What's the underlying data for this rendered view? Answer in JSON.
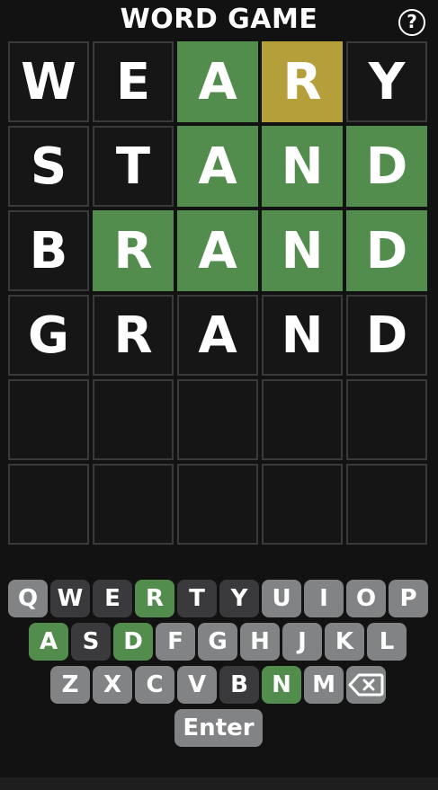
{
  "header": {
    "title": "WORD GAME",
    "help_label": "?"
  },
  "colors": {
    "correct": "#538d4e",
    "present": "#b59f3b",
    "absent": "#3a3a3c",
    "unused_key": "#818384",
    "background": "#121212"
  },
  "board": {
    "rows": [
      [
        {
          "letter": "W",
          "state": "absent"
        },
        {
          "letter": "E",
          "state": "absent"
        },
        {
          "letter": "A",
          "state": "correct"
        },
        {
          "letter": "R",
          "state": "present"
        },
        {
          "letter": "Y",
          "state": "absent"
        }
      ],
      [
        {
          "letter": "S",
          "state": "absent"
        },
        {
          "letter": "T",
          "state": "absent"
        },
        {
          "letter": "A",
          "state": "correct"
        },
        {
          "letter": "N",
          "state": "correct"
        },
        {
          "letter": "D",
          "state": "correct"
        }
      ],
      [
        {
          "letter": "B",
          "state": "absent"
        },
        {
          "letter": "R",
          "state": "correct"
        },
        {
          "letter": "A",
          "state": "correct"
        },
        {
          "letter": "N",
          "state": "correct"
        },
        {
          "letter": "D",
          "state": "correct"
        }
      ],
      [
        {
          "letter": "G",
          "state": "absent"
        },
        {
          "letter": "R",
          "state": "absent"
        },
        {
          "letter": "A",
          "state": "absent"
        },
        {
          "letter": "N",
          "state": "absent"
        },
        {
          "letter": "D",
          "state": "absent"
        }
      ],
      [
        {
          "letter": "",
          "state": "empty"
        },
        {
          "letter": "",
          "state": "empty"
        },
        {
          "letter": "",
          "state": "empty"
        },
        {
          "letter": "",
          "state": "empty"
        },
        {
          "letter": "",
          "state": "empty"
        }
      ],
      [
        {
          "letter": "",
          "state": "empty"
        },
        {
          "letter": "",
          "state": "empty"
        },
        {
          "letter": "",
          "state": "empty"
        },
        {
          "letter": "",
          "state": "empty"
        },
        {
          "letter": "",
          "state": "empty"
        }
      ]
    ]
  },
  "keyboard": {
    "rows": [
      [
        {
          "label": "Q",
          "state": "unused"
        },
        {
          "label": "W",
          "state": "absent"
        },
        {
          "label": "E",
          "state": "absent"
        },
        {
          "label": "R",
          "state": "correct"
        },
        {
          "label": "T",
          "state": "absent"
        },
        {
          "label": "Y",
          "state": "absent"
        },
        {
          "label": "U",
          "state": "unused"
        },
        {
          "label": "I",
          "state": "unused"
        },
        {
          "label": "O",
          "state": "unused"
        },
        {
          "label": "P",
          "state": "unused"
        }
      ],
      [
        {
          "label": "A",
          "state": "correct"
        },
        {
          "label": "S",
          "state": "absent"
        },
        {
          "label": "D",
          "state": "correct"
        },
        {
          "label": "F",
          "state": "unused"
        },
        {
          "label": "G",
          "state": "unused"
        },
        {
          "label": "H",
          "state": "unused"
        },
        {
          "label": "J",
          "state": "unused"
        },
        {
          "label": "K",
          "state": "unused"
        },
        {
          "label": "L",
          "state": "unused"
        }
      ],
      [
        {
          "label": "Z",
          "state": "unused"
        },
        {
          "label": "X",
          "state": "unused"
        },
        {
          "label": "C",
          "state": "unused"
        },
        {
          "label": "V",
          "state": "unused"
        },
        {
          "label": "B",
          "state": "absent"
        },
        {
          "label": "N",
          "state": "correct"
        },
        {
          "label": "M",
          "state": "unused"
        },
        {
          "label": "",
          "state": "unused",
          "icon": "backspace-icon"
        }
      ],
      [
        {
          "label": "Enter",
          "state": "unused"
        }
      ]
    ]
  }
}
